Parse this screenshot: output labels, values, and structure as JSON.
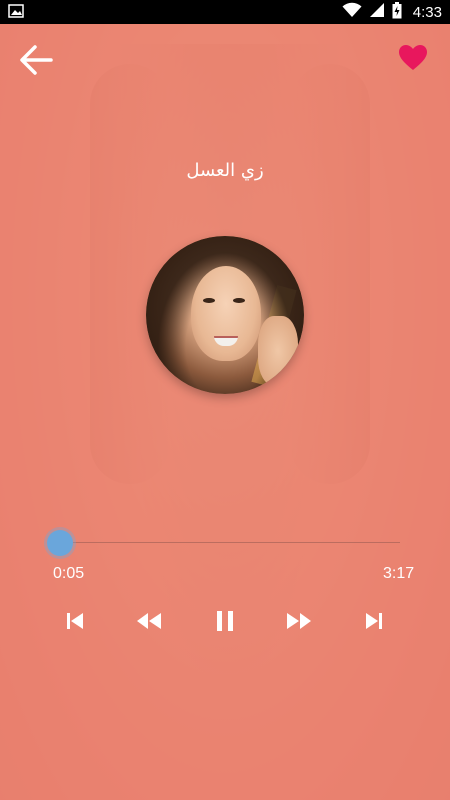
{
  "status_bar": {
    "time": "4:33",
    "icons": [
      "image-icon",
      "wifi-icon",
      "signal-icon",
      "battery-charging-icon"
    ]
  },
  "header": {
    "back_icon": "arrow-left-icon",
    "favorite_icon": "heart-icon",
    "favorite_color": "#e8175d"
  },
  "song": {
    "title": "زي العسل"
  },
  "player": {
    "elapsed": "0:05",
    "total": "3:17",
    "progress": 0.025,
    "accent_color": "#6aa6db",
    "controls": [
      "skip-previous-icon",
      "rewind-icon",
      "pause-icon",
      "fast-forward-icon",
      "skip-next-icon"
    ]
  },
  "colors": {
    "overlay": "#ec806c",
    "status_bar": "#000000"
  }
}
